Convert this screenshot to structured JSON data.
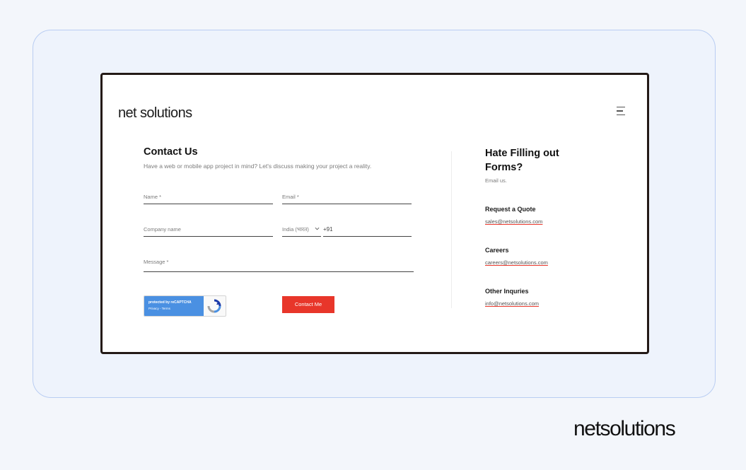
{
  "site": {
    "logo_text": "net solutions",
    "menu_icon": "hamburger-menu-icon"
  },
  "form": {
    "title": "Contact Us",
    "subtitle": "Have a web or mobile app project in mind? Let's discuss making your project a reality.",
    "fields": {
      "name_label": "Name *",
      "email_label": "Email *",
      "company_label": "Company name",
      "country_value": "India (भारत)",
      "phone_code": "+91",
      "message_label": "Message *"
    },
    "captcha": {
      "text": "protected by reCAPTCHA",
      "links": "Privacy - Terms",
      "icon": "recaptcha-icon"
    },
    "submit_label": "Contact Me"
  },
  "side": {
    "title": "Hate Filling out Forms?",
    "subtitle": "Email us.",
    "contacts": [
      {
        "heading": "Request a Quote",
        "email": "sales@netsolutions.com"
      },
      {
        "heading": "Careers",
        "email": "careers@netsolutions.com"
      },
      {
        "heading": "Other Inquries",
        "email": "info@netsolutions.com"
      }
    ]
  },
  "brand": {
    "logo_text": "netsolutions"
  },
  "colors": {
    "accent": "#e8362a",
    "frame_border": "#b9cdf2",
    "captcha_blue": "#4a90e2"
  }
}
